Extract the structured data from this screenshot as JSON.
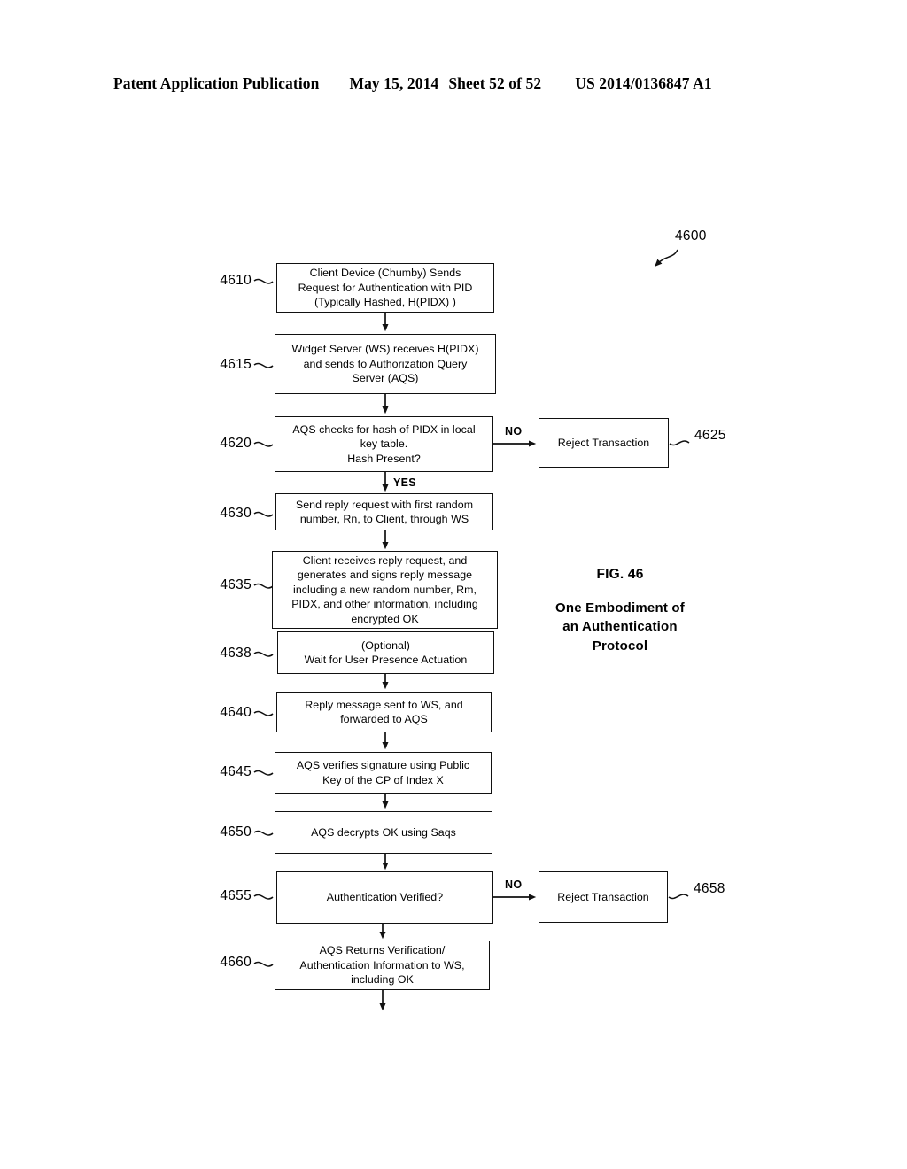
{
  "header": {
    "publication": "Patent Application Publication",
    "date": "May 15, 2014",
    "sheet": "Sheet 52 of 52",
    "patent_number": "US 2014/0136847 A1"
  },
  "figure": {
    "number": "FIG. 46",
    "title": "One Embodiment of\nan Authentication\nProtocol",
    "diagram_ref": "4600"
  },
  "flowchart": {
    "type": "flowchart",
    "nodes": [
      {
        "ref": "4610",
        "text": "Client Device (Chumby) Sends\nRequest for Authentication with PID\n(Typically Hashed, H(PIDX) )",
        "shape": "process"
      },
      {
        "ref": "4615",
        "text": "Widget Server (WS) receives H(PIDX)\nand sends to Authorization Query\nServer (AQS)",
        "shape": "process"
      },
      {
        "ref": "4620",
        "text": "AQS checks for hash of PIDX in local\nkey table.\nHash Present?",
        "shape": "decision"
      },
      {
        "ref": "4625",
        "text": "Reject Transaction",
        "shape": "terminator"
      },
      {
        "ref": "4630",
        "text": "Send reply request with first random\nnumber, Rn, to Client, through WS",
        "shape": "process"
      },
      {
        "ref": "4635",
        "text": "Client receives reply request, and\ngenerates and signs reply message\nincluding a new random number, Rm,\nPIDX, and other information, including\nencrypted OK",
        "shape": "process"
      },
      {
        "ref": "4638",
        "text": "(Optional)\nWait for User Presence Actuation",
        "shape": "process"
      },
      {
        "ref": "4640",
        "text": "Reply message sent to WS, and\nforwarded to AQS",
        "shape": "process"
      },
      {
        "ref": "4645",
        "text": "AQS verifies signature using Public\nKey of the CP of Index X",
        "shape": "process"
      },
      {
        "ref": "4650",
        "text": "AQS decrypts OK using Saqs",
        "shape": "process"
      },
      {
        "ref": "4655",
        "text": "Authentication Verified?",
        "shape": "decision"
      },
      {
        "ref": "4658",
        "text": "Reject Transaction",
        "shape": "terminator"
      },
      {
        "ref": "4660",
        "text": "AQS Returns Verification/\nAuthentication Information to WS,\nincluding OK",
        "shape": "process"
      }
    ],
    "edge_labels": {
      "no_upper": "NO",
      "yes_upper": "YES",
      "no_lower": "NO"
    }
  }
}
